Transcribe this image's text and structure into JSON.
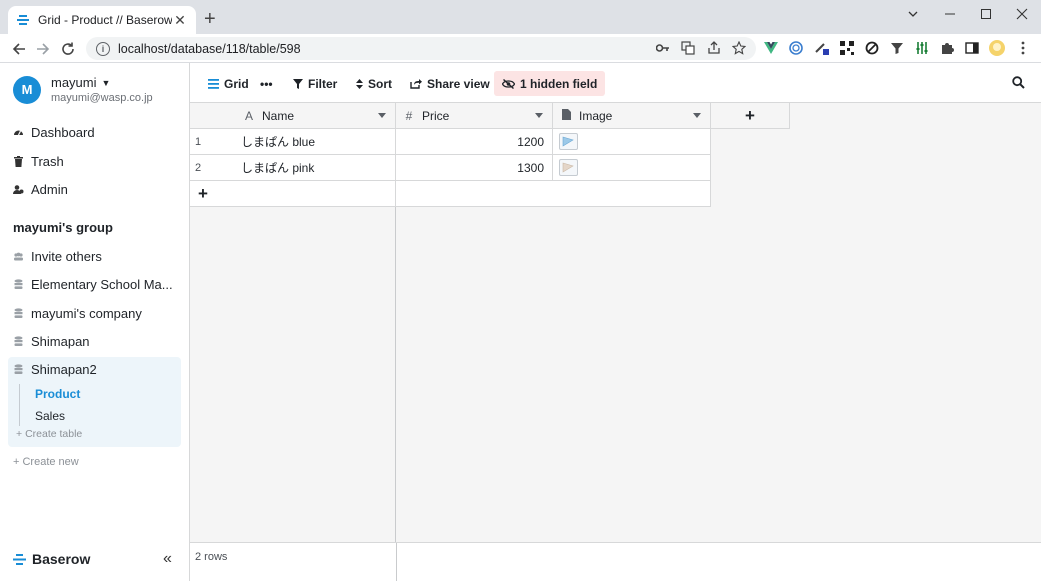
{
  "browser": {
    "tab_title": "Grid - Product // Baserow",
    "url": "localhost/database/118/table/598"
  },
  "user": {
    "initial": "M",
    "name": "mayumi",
    "email": "mayumi@wasp.co.jp"
  },
  "sidebar": {
    "nav": [
      {
        "label": "Dashboard",
        "icon": "dashboard-icon"
      },
      {
        "label": "Trash",
        "icon": "trash-icon"
      },
      {
        "label": "Admin",
        "icon": "admin-icon"
      }
    ],
    "group_title": "mayumi's group",
    "invite": "Invite others",
    "databases": [
      "Elementary School Ma...",
      "mayumi's company",
      "Shimapan",
      "Shimapan2"
    ],
    "tables": [
      "Product",
      "Sales"
    ],
    "create_table": "Create table",
    "create_new": "Create new",
    "brand": "Baserow"
  },
  "header": {
    "view": "Grid",
    "filter": "Filter",
    "sort": "Sort",
    "share": "Share view",
    "hidden": "1 hidden field"
  },
  "grid": {
    "columns": [
      {
        "name": "Name",
        "type_icon": "A"
      },
      {
        "name": "Price",
        "type_icon": "#"
      },
      {
        "name": "Image",
        "type_icon": "file"
      }
    ],
    "rows": [
      {
        "id": "1",
        "name": "しまぱん blue",
        "price": "1200"
      },
      {
        "id": "2",
        "name": "しまぱん pink",
        "price": "1300"
      }
    ],
    "add_row": "+",
    "add_field": "+",
    "row_count": "2 rows"
  },
  "colors": {
    "accent": "#198dd6",
    "hidden_field_bg": "#fce4e4",
    "active_db_bg": "#edf5fa"
  }
}
